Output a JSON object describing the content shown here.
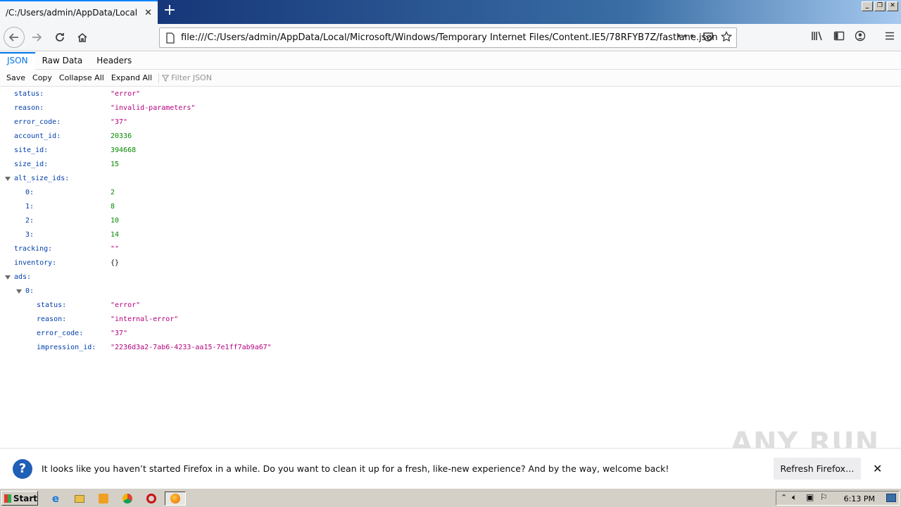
{
  "browser": {
    "tab_title": "/C:/Users/admin/AppData/Local/Microsoft/Windows/Temporary Internet Files/Content.IE5/78RFYB7Z/fastlane.json",
    "url": "file:///C:/Users/admin/AppData/Local/Microsoft/Windows/Temporary Internet Files/Content.IE5/78RFYB7Z/fastlane.json"
  },
  "viewer": {
    "tabs": [
      "JSON",
      "Raw Data",
      "Headers"
    ],
    "toolbar": {
      "save": "Save",
      "copy": "Copy",
      "collapse": "Collapse All",
      "expand": "Expand All",
      "filter_placeholder": "Filter JSON"
    }
  },
  "json_rows": [
    {
      "key": "status:",
      "value": "\"error\"",
      "type": "str",
      "indent": 0
    },
    {
      "key": "reason:",
      "value": "\"invalid-parameters\"",
      "type": "str",
      "indent": 0
    },
    {
      "key": "error_code:",
      "value": "\"37\"",
      "type": "str",
      "indent": 0
    },
    {
      "key": "account_id:",
      "value": "20336",
      "type": "num",
      "indent": 0
    },
    {
      "key": "site_id:",
      "value": "394668",
      "type": "num",
      "indent": 0
    },
    {
      "key": "size_id:",
      "value": "15",
      "type": "num",
      "indent": 0
    },
    {
      "key": "alt_size_ids:",
      "value": "",
      "type": "obj",
      "indent": 0,
      "expanded": true
    },
    {
      "key": "0:",
      "value": "2",
      "type": "num",
      "indent": 1
    },
    {
      "key": "1:",
      "value": "8",
      "type": "num",
      "indent": 1
    },
    {
      "key": "2:",
      "value": "10",
      "type": "num",
      "indent": 1
    },
    {
      "key": "3:",
      "value": "14",
      "type": "num",
      "indent": 1
    },
    {
      "key": "tracking:",
      "value": "\"\"",
      "type": "str",
      "indent": 0
    },
    {
      "key": "inventory:",
      "value": "{}",
      "type": "brace",
      "indent": 0
    },
    {
      "key": "ads:",
      "value": "",
      "type": "obj",
      "indent": 0,
      "expanded": true
    },
    {
      "key": "0:",
      "value": "",
      "type": "obj",
      "indent": 1,
      "expanded": true
    },
    {
      "key": "status:",
      "value": "\"error\"",
      "type": "str",
      "indent": 2
    },
    {
      "key": "reason:",
      "value": "\"internal-error\"",
      "type": "str",
      "indent": 2
    },
    {
      "key": "error_code:",
      "value": "\"37\"",
      "type": "str",
      "indent": 2
    },
    {
      "key": "impression_id:",
      "value": "\"2236d3a2-7ab6-4233-aa15-7e1ff7ab9a67\"",
      "type": "str",
      "indent": 2
    }
  ],
  "notification": {
    "text": "It looks like you haven’t started Firefox in a while. Do you want to clean it up for a fresh, like-new experience? And by the way, welcome back!",
    "button": "Refresh Firefox…"
  },
  "watermark": "ANY RUN",
  "taskbar": {
    "start": "Start",
    "clock": "6:13 PM"
  },
  "colors": {
    "accent": "#0074e8",
    "string": "#b5007f",
    "number": "#058b00",
    "key": "#003eaa"
  }
}
